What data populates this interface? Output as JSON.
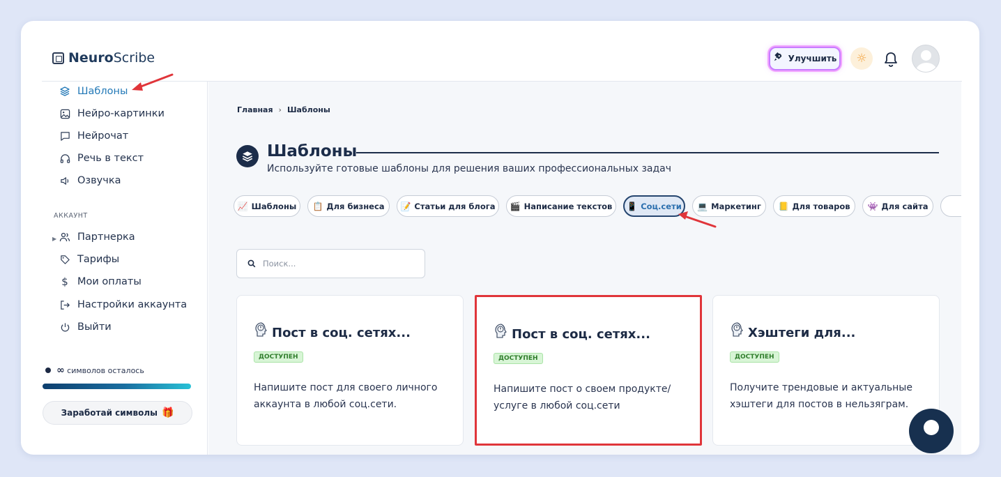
{
  "app": {
    "logo_bold": "Neuro",
    "logo_light": "Scribe"
  },
  "header": {
    "upgrade_label": "Улучшить",
    "icons": [
      "rocket-icon",
      "sun-icon",
      "bell-icon",
      "avatar"
    ]
  },
  "sidebar": {
    "items": [
      {
        "label": "Шаблоны",
        "icon": "layers-icon",
        "active": true
      },
      {
        "label": "Нейро-картинки",
        "icon": "image-icon"
      },
      {
        "label": "Нейрочат",
        "icon": "chat-icon"
      },
      {
        "label": "Речь в текст",
        "icon": "headphones-icon"
      },
      {
        "label": "Озвучка",
        "icon": "speaker-icon"
      }
    ],
    "section_label": "АККАУНТ",
    "account_items": [
      {
        "label": "Партнерка",
        "icon": "users-icon"
      },
      {
        "label": "Тарифы",
        "icon": "tag-icon"
      },
      {
        "label": "Мои оплаты",
        "icon": "dollar-icon"
      },
      {
        "label": "Настройки аккаунта",
        "icon": "login-icon"
      },
      {
        "label": "Выйти",
        "icon": "power-icon"
      }
    ],
    "chars_symbol": "∞",
    "chars_text": "символов осталось",
    "chars_progress": 1.0,
    "earn_label": "Заработай символы"
  },
  "main": {
    "breadcrumb": {
      "home": "Главная",
      "sep": "›",
      "current": "Шаблоны"
    },
    "title": "Шаблоны",
    "subtitle": "Используйте готовые шаблоны для решения ваших профессиональных задач",
    "chips": [
      {
        "label": "Шаблоны",
        "emoji": "📈"
      },
      {
        "label": "Для бизнеса",
        "emoji": "📋"
      },
      {
        "label": "Статьи для блога",
        "emoji": "📝"
      },
      {
        "label": "Написание текстов",
        "emoji": "🎬"
      },
      {
        "label": "Соц.сети",
        "emoji": "📱",
        "active": true
      },
      {
        "label": "Маркетинг",
        "emoji": "💻"
      },
      {
        "label": "Для товаров",
        "emoji": "📒"
      },
      {
        "label": "Для сайта",
        "emoji": "👾"
      }
    ],
    "search_placeholder": "Поиск...",
    "cards": [
      {
        "title": "Пост в соц. сетях...",
        "badge": "ДОСТУПЕН",
        "desc": "Напишите пост для своего личного аккаунта в любой соц.сети."
      },
      {
        "title": "Пост в соц. сетях...",
        "badge": "ДОСТУПЕН",
        "desc": "Напишите пост о своем продукте/ услуге в любой соц.сети",
        "highlighted": true
      },
      {
        "title": "Хэштеги для...",
        "badge": "ДОСТУПЕН",
        "desc": "Получите трендовые и актуальные хэштеги для постов в нельзяграм."
      }
    ]
  },
  "colors": {
    "accent": "#2379b7",
    "dark": "#1c2d4a",
    "highlight": "#e0353a",
    "badge_bg": "#d8f5d6"
  }
}
